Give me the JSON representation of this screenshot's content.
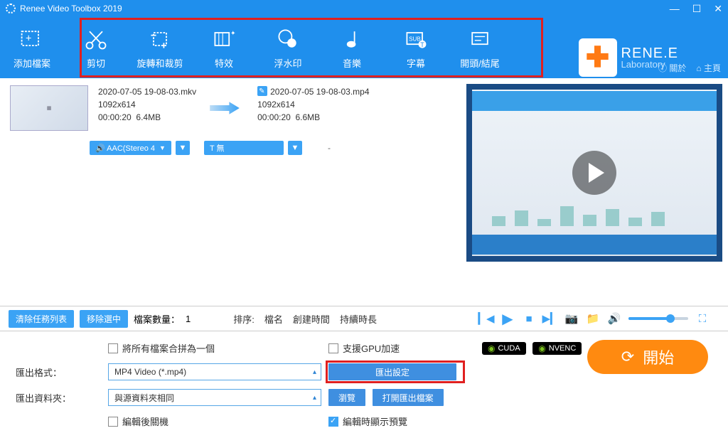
{
  "app": {
    "title": "Renee Video Toolbox 2019"
  },
  "toolbar": {
    "add": "添加檔案",
    "cut": "剪切",
    "rotate": "旋轉和裁剪",
    "effect": "特效",
    "watermark": "浮水印",
    "music": "音樂",
    "subtitle": "字幕",
    "headtail": "開頭/結尾",
    "about": "關於",
    "home": "主頁"
  },
  "logo": {
    "main": "RENE.E",
    "sub": "Laboratory"
  },
  "file": {
    "src_name": "2020-07-05 19-08-03.mkv",
    "src_res": "1092x614",
    "src_dur": "00:00:20",
    "src_size": "6.4MB",
    "dst_name": "2020-07-05 19-08-03.mp4",
    "dst_res": "1092x614",
    "dst_dur": "00:00:20",
    "dst_size": "6.6MB",
    "audio_badge": "🔊 AAC(Stereo 4",
    "text_badge": "T 無",
    "dash": "-"
  },
  "list": {
    "clear": "清除任務列表",
    "remove": "移除選中",
    "count_label": "檔案數量：",
    "count": "1",
    "sort_label": "排序:",
    "sort_name": "檔名",
    "sort_time": "創建時間",
    "sort_len": "持續時長"
  },
  "bottom": {
    "merge": "將所有檔案合拼為一個",
    "gpu": "支援GPU加速",
    "cuda": "CUDA",
    "nvenc": "NVENC",
    "format_label": "匯出格式：",
    "format_value": "MP4 Video (*.mp4)",
    "export_settings": "匯出設定",
    "folder_label": "匯出資料夾：",
    "folder_value": "與源資料夾相同",
    "browse": "瀏覽",
    "open_folder": "打開匯出檔案",
    "shutdown": "編輯後關機",
    "preview": "編輯時顯示預覽",
    "start": "開始"
  }
}
